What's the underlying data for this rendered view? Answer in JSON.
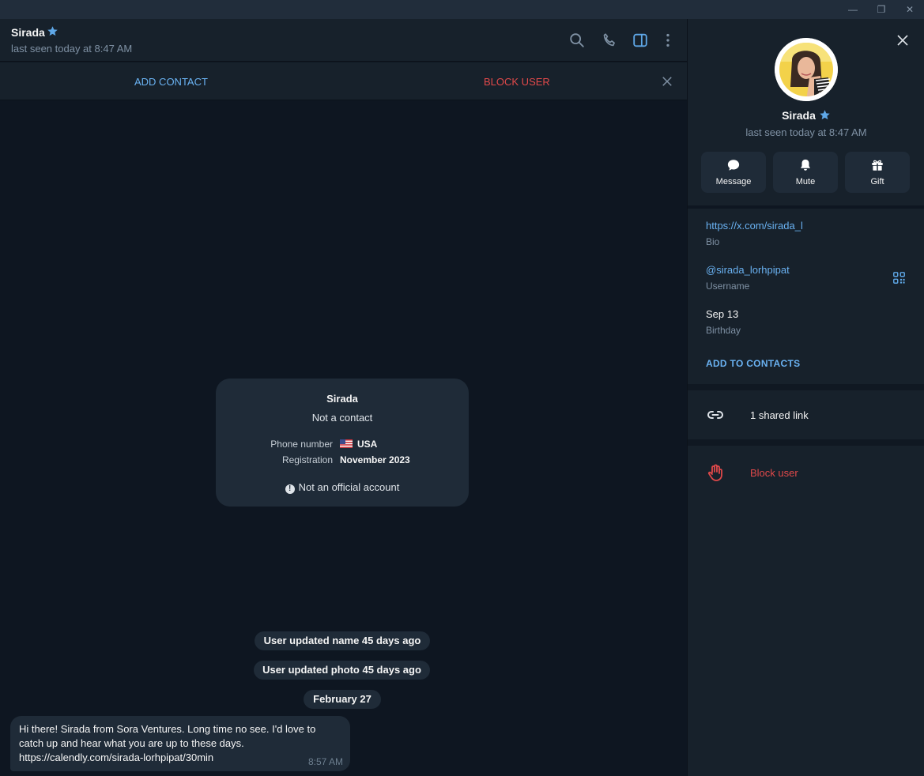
{
  "window": {
    "minimize_glyph": "—",
    "restore_glyph": "❐",
    "close_glyph": "✕"
  },
  "chat": {
    "name": "Sirada",
    "status": "last seen today at 8:47 AM",
    "header_icons": [
      "search-icon",
      "phone-icon",
      "sidebar-toggle-icon",
      "more-vertical-icon"
    ]
  },
  "action_bar": {
    "add_contact": "ADD CONTACT",
    "block_user": "BLOCK USER"
  },
  "info_card": {
    "name": "Sirada",
    "subtitle": "Not a contact",
    "rows": [
      {
        "key": "Phone number",
        "value": "USA"
      },
      {
        "key": "Registration",
        "value": "November 2023"
      }
    ],
    "note": "Not an official account"
  },
  "service_messages": [
    "User updated name 45 days ago",
    "User updated photo 45 days ago",
    "February 27"
  ],
  "message": {
    "text": "Hi there! Sirada from Sora Ventures. Long time no see. I'd love to catch up and hear what you are up to these days. https://calendly.com/sirada-lorhpipat/30min",
    "time": "8:57 AM"
  },
  "panel": {
    "name": "Sirada",
    "status": "last seen today at 8:47 AM",
    "buttons": [
      {
        "label": "Message",
        "icon": "message-icon"
      },
      {
        "label": "Mute",
        "icon": "bell-icon"
      },
      {
        "label": "Gift",
        "icon": "gift-icon"
      }
    ],
    "bio_value": "https://x.com/sirada_l",
    "bio_label": "Bio",
    "username_value": "@sirada_lorhpipat",
    "username_label": "Username",
    "birthday_value": "Sep 13",
    "birthday_label": "Birthday",
    "add_to_contacts": "ADD TO CONTACTS",
    "shared_links": "1 shared link",
    "block_user": "Block user"
  },
  "colors": {
    "background": "#0e1621",
    "surface": "#17212b",
    "bubble": "#1f2b38",
    "accent": "#6ab2f2",
    "danger": "#e0494a",
    "muted": "#7f91a4"
  }
}
